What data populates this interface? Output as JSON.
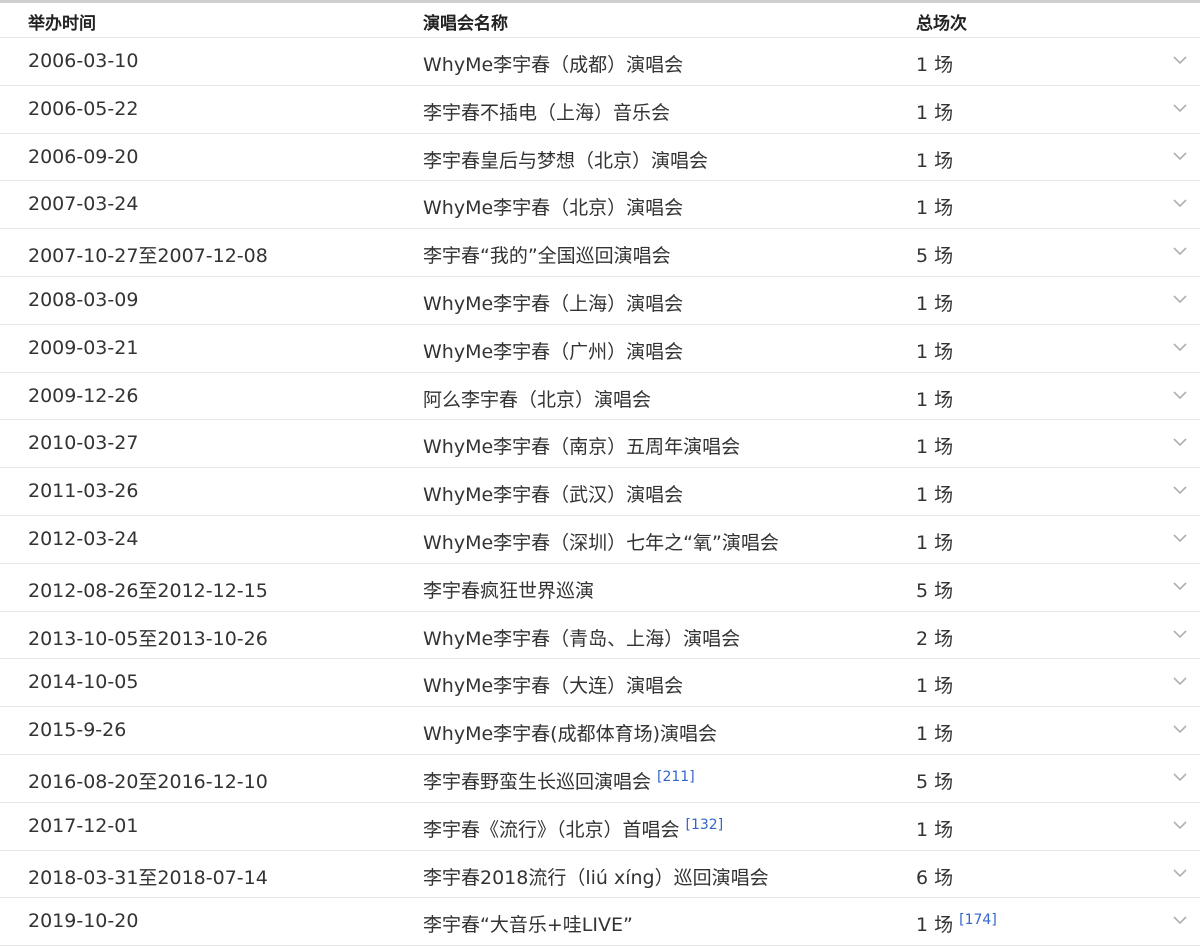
{
  "header": {
    "date": "举办时间",
    "name": "演唱会名称",
    "count": "总场次"
  },
  "rows": [
    {
      "date": "2006-03-10",
      "name": "WhyMe李宇春（成都）演唱会",
      "count": "1 场",
      "ref": ""
    },
    {
      "date": "2006-05-22",
      "name": "李宇春不插电（上海）音乐会",
      "count": "1 场",
      "ref": ""
    },
    {
      "date": "2006-09-20",
      "name": "李宇春皇后与梦想（北京）演唱会",
      "count": "1 场",
      "ref": ""
    },
    {
      "date": "2007-03-24",
      "name": "WhyMe李宇春（北京）演唱会",
      "count": "1 场",
      "ref": ""
    },
    {
      "date": "2007-10-27至2007-12-08",
      "name": "李宇春“我的”全国巡回演唱会",
      "count": "5 场",
      "ref": ""
    },
    {
      "date": "2008-03-09",
      "name": "WhyMe李宇春（上海）演唱会",
      "count": "1 场",
      "ref": ""
    },
    {
      "date": "2009-03-21",
      "name": "WhyMe李宇春（广州）演唱会",
      "count": "1 场",
      "ref": ""
    },
    {
      "date": "2009-12-26",
      "name": "阿么李宇春（北京）演唱会",
      "count": "1 场",
      "ref": ""
    },
    {
      "date": "2010-03-27",
      "name": "WhyMe李宇春（南京）五周年演唱会",
      "count": "1 场",
      "ref": ""
    },
    {
      "date": "2011-03-26",
      "name": "WhyMe李宇春（武汉）演唱会",
      "count": "1 场",
      "ref": ""
    },
    {
      "date": "2012-03-24",
      "name": "WhyMe李宇春（深圳）七年之“氧”演唱会",
      "count": "1 场",
      "ref": ""
    },
    {
      "date": "2012-08-26至2012-12-15",
      "name": "李宇春疯狂世界巡演",
      "count": "5 场",
      "ref": ""
    },
    {
      "date": "2013-10-05至2013-10-26",
      "name": "WhyMe李宇春（青岛、上海）演唱会",
      "count": "2 场",
      "ref": ""
    },
    {
      "date": "2014-10-05",
      "name": "WhyMe李宇春（大连）演唱会",
      "count": "1 场",
      "ref": ""
    },
    {
      "date": "2015-9-26",
      "name": "WhyMe李宇春(成都体育场)演唱会",
      "count": "1 场",
      "ref": ""
    },
    {
      "date": "2016-08-20至2016-12-10",
      "name": "李宇春野蛮生长巡回演唱会",
      "count": "5 场",
      "ref": "[211]"
    },
    {
      "date": "2017-12-01",
      "name": "李宇春《流行》（北京）首唱会",
      "count": "1 场",
      "ref": "[132]"
    },
    {
      "date": "2018-03-31至2018-07-14",
      "name": "李宇春2018流行（liú xíng）巡回演唱会",
      "count": "6 场",
      "ref": ""
    },
    {
      "date": "2019-10-20",
      "name": "李宇春“大音乐+哇LIVE”",
      "count": "1 场",
      "ref": "",
      "count_ref": "[174]"
    }
  ],
  "icons": {
    "row_toggle": "chevron-down-icon"
  },
  "colors": {
    "ref_link": "#3366cc",
    "chevron": "#b0b0b0",
    "divider": "#e8e8e8"
  }
}
